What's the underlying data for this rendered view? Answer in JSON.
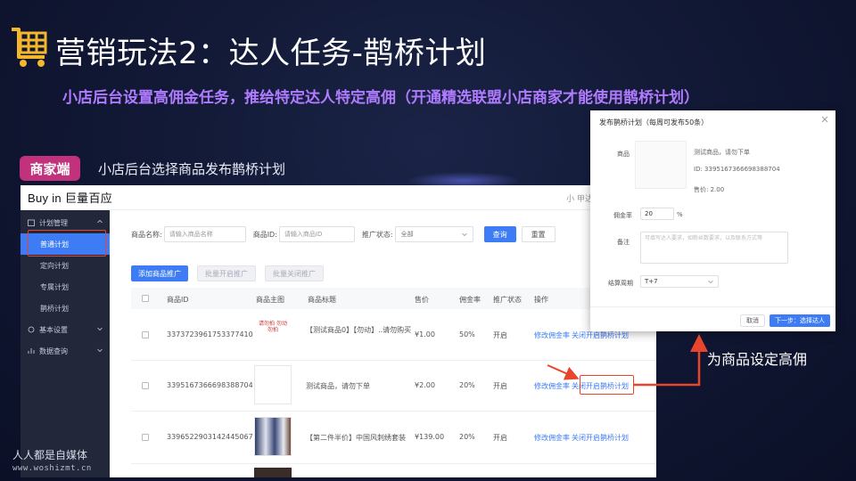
{
  "slide": {
    "title": "营销玩法2：达人任务-鹊桥计划",
    "subtitle": "小店后台设置高佣金任务，推给特定达人特定高佣（开通精选联盟小店商家才能使用鹊桥计划）",
    "badge": "商家端",
    "section_caption": "小店后台选择商品发布鹊桥计划",
    "annotation": "为商品设定高佣",
    "watermark_line1": "人人都是自媒体",
    "watermark_line2": "www.woshizmt.cn",
    "accent_color": "#b07bff",
    "badge_color": "#c2327c",
    "highlight_color": "#e8452d"
  },
  "app": {
    "brand": "Buy in 巨量百应",
    "top_right": "小 甲达人",
    "sidebar": {
      "group1": "计划管理",
      "items": [
        "普通计划",
        "定向计划",
        "专属计划",
        "鹊桥计划"
      ],
      "group2": "基本设置",
      "group3": "数据查询"
    },
    "filters": {
      "name_label": "商品名称:",
      "name_placeholder": "请输入商品名称",
      "id_label": "商品ID:",
      "id_placeholder": "请输入商品ID",
      "status_label": "推广状态:",
      "status_value": "全部",
      "search_btn": "查询",
      "reset_btn": "重置"
    },
    "actions": {
      "add": "添加商品推广",
      "batch_open": "批量开启推广",
      "batch_close": "批量关闭推广"
    },
    "table": {
      "headers": [
        "商品ID",
        "商品主图",
        "商品标题",
        "售价",
        "佣金率",
        "推广状态",
        "操作"
      ],
      "rows": [
        {
          "id": "3373723961753377410",
          "thumb_text": "请勿拍 勿动 勿拍",
          "title": "【测试商品0】【勿动】..请勿购买",
          "price": "¥1.00",
          "rate": "50%",
          "status": "开启",
          "op1": "修改佣金率",
          "op2": "关闭",
          "op3": "开启鹊桥计划"
        },
        {
          "id": "3395167366698388704",
          "thumb_text": "",
          "title": "测试商品，请勿下单",
          "price": "¥2.00",
          "rate": "20%",
          "status": "开启",
          "op1": "修改佣金率",
          "op2": "关闭",
          "op3": "开启鹊桥计划"
        },
        {
          "id": "3396522903142445067",
          "thumb_text": "",
          "title": "【第二件半价】中国风刺绣套装",
          "price": "¥139.00",
          "rate": "20%",
          "status": "开启",
          "op1": "修改佣金率",
          "op2": "关闭",
          "op3": "开启鹊桥计划"
        }
      ]
    }
  },
  "modal": {
    "title": "发布鹊桥计划（每周可发布50条）",
    "product_label": "商品",
    "product_name": "测试商品，请勿下单",
    "product_id": "ID: 3395167366698388704",
    "product_price": "售价: 2.00",
    "rate_label": "佣金率",
    "rate_value": "20",
    "rate_unit": "%",
    "note_label": "备注",
    "note_placeholder": "可填写达人要求，如粉丝数要求，以及联系方式等",
    "cycle_label": "结算周期",
    "cycle_value": "T+7",
    "cancel_btn": "取消",
    "ok_btn": "下一步：选择达人"
  }
}
